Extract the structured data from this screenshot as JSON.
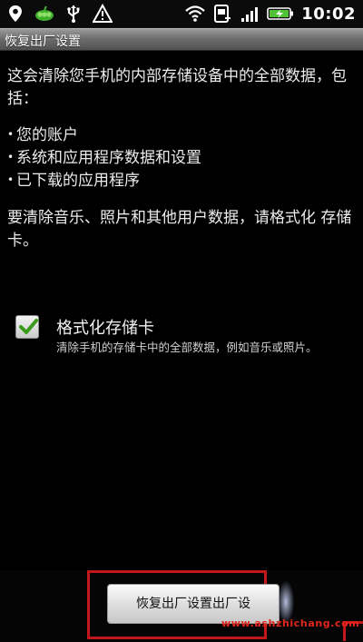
{
  "status_bar": {
    "time": "10:02",
    "left_icons": [
      "location-pin-icon",
      "peas-app-icon",
      "usb-icon",
      "warning-icon"
    ],
    "right_icons": [
      "wifi-icon",
      "sync-icon",
      "signal-icon",
      "battery-charging-icon"
    ]
  },
  "title_bar": {
    "title": "恢复出厂设置"
  },
  "content": {
    "intro": "这会清除您手机的内部存储设备中的全部数据，包括：",
    "bullets": [
      "您的账户",
      "系统和应用程序数据和设置",
      "已下载的应用程序"
    ],
    "notice": "要清除音乐、照片和其他用户数据，请格式化 存储卡。"
  },
  "option": {
    "checked": true,
    "label": "格式化存储卡",
    "description": "清除手机的存储卡中的全部数据，例如音乐或照片。"
  },
  "bottom": {
    "reset_button_label": "恢复出厂设置出厂设",
    "watermark": "www.ashzhichang.com"
  },
  "colors": {
    "background": "#000000",
    "highlight": "#c4171b",
    "watermark": "#e1261c",
    "check_green": "#3a9a1c"
  }
}
